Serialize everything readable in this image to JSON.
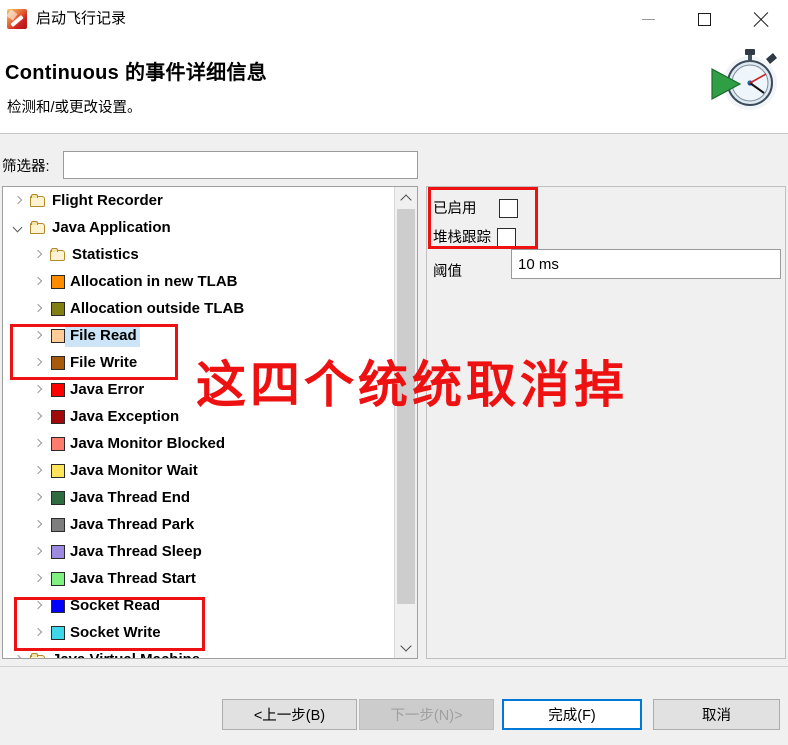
{
  "window": {
    "title": "启动飞行记录",
    "icon": "jfr-rocket-icon",
    "minimize_label": "—",
    "maximize_label": "□",
    "close_label": "✕"
  },
  "header": {
    "title": "Continuous 的事件详细信息",
    "description": "检测和/或更改设置。",
    "logo_icon": "stopwatch-play-icon"
  },
  "filter": {
    "label": "筛选器:",
    "value": "",
    "placeholder": ""
  },
  "tree": {
    "items": [
      {
        "label": "Flight Recorder",
        "indent": 0,
        "icon": "folder-icon",
        "twisty": "collapsed",
        "selected": false
      },
      {
        "label": "Java Application",
        "indent": 0,
        "icon": "folder-icon",
        "twisty": "expanded",
        "selected": false
      },
      {
        "label": "Statistics",
        "indent": 1,
        "icon": "folder-icon",
        "twisty": "collapsed",
        "selected": false
      },
      {
        "label": "Allocation in new TLAB",
        "indent": 1,
        "icon": "square-icon",
        "color": "#FF8C00",
        "twisty": "collapsed",
        "selected": false
      },
      {
        "label": "Allocation outside TLAB",
        "indent": 1,
        "icon": "square-icon",
        "color": "#7F7F14",
        "twisty": "collapsed",
        "selected": false
      },
      {
        "label": "File Read",
        "indent": 1,
        "icon": "square-icon",
        "color": "#FFCC99",
        "twisty": "collapsed",
        "selected": true
      },
      {
        "label": "File Write",
        "indent": 1,
        "icon": "square-icon",
        "color": "#A75A0C",
        "twisty": "collapsed",
        "selected": false
      },
      {
        "label": "Java Error",
        "indent": 1,
        "icon": "square-icon",
        "color": "#FF0000",
        "twisty": "collapsed",
        "selected": false
      },
      {
        "label": "Java Exception",
        "indent": 1,
        "icon": "square-icon",
        "color": "#A00A0A",
        "twisty": "collapsed",
        "selected": false
      },
      {
        "label": "Java Monitor Blocked",
        "indent": 1,
        "icon": "square-icon",
        "color": "#FF7B6E",
        "twisty": "collapsed",
        "selected": false
      },
      {
        "label": "Java Monitor Wait",
        "indent": 1,
        "icon": "square-icon",
        "color": "#FFE45C",
        "twisty": "collapsed",
        "selected": false
      },
      {
        "label": "Java Thread End",
        "indent": 1,
        "icon": "square-icon",
        "color": "#2E6B3E",
        "twisty": "collapsed",
        "selected": false
      },
      {
        "label": "Java Thread Park",
        "indent": 1,
        "icon": "square-icon",
        "color": "#7D7D7D",
        "twisty": "collapsed",
        "selected": false
      },
      {
        "label": "Java Thread Sleep",
        "indent": 1,
        "icon": "square-icon",
        "color": "#9C8BE0",
        "twisty": "collapsed",
        "selected": false
      },
      {
        "label": "Java Thread Start",
        "indent": 1,
        "icon": "square-icon",
        "color": "#80F080",
        "twisty": "collapsed",
        "selected": false
      },
      {
        "label": "Socket Read",
        "indent": 1,
        "icon": "square-icon",
        "color": "#0000FF",
        "twisty": "collapsed",
        "selected": false
      },
      {
        "label": "Socket Write",
        "indent": 1,
        "icon": "square-icon",
        "color": "#3FD6E8",
        "twisty": "collapsed",
        "selected": false
      },
      {
        "label": "Java Virtual Machine",
        "indent": 0,
        "icon": "folder-icon",
        "twisty": "collapsed",
        "selected": false
      }
    ]
  },
  "details": {
    "enabled_label": "已启用",
    "enabled_checked": false,
    "stacktrace_label": "堆栈跟踪",
    "stacktrace_checked": false,
    "threshold_label": "阈值",
    "threshold_value": "10 ms"
  },
  "footer": {
    "back_label": "<上一步(B)",
    "next_label": "下一步(N)>",
    "finish_label": "完成(F)",
    "cancel_label": "取消"
  },
  "annotations": {
    "note_text": "这四个统统取消掉",
    "accent_color": "#EE1111"
  }
}
